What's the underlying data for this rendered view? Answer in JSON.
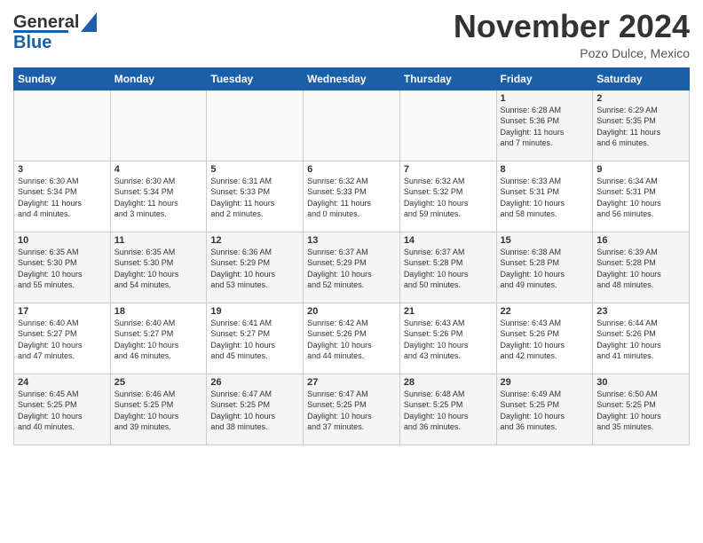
{
  "header": {
    "logo_general": "General",
    "logo_blue": "Blue",
    "month_title": "November 2024",
    "location": "Pozo Dulce, Mexico"
  },
  "weekdays": [
    "Sunday",
    "Monday",
    "Tuesday",
    "Wednesday",
    "Thursday",
    "Friday",
    "Saturday"
  ],
  "weeks": [
    [
      {
        "day": "",
        "info": ""
      },
      {
        "day": "",
        "info": ""
      },
      {
        "day": "",
        "info": ""
      },
      {
        "day": "",
        "info": ""
      },
      {
        "day": "",
        "info": ""
      },
      {
        "day": "1",
        "info": "Sunrise: 6:28 AM\nSunset: 5:36 PM\nDaylight: 11 hours\nand 7 minutes."
      },
      {
        "day": "2",
        "info": "Sunrise: 6:29 AM\nSunset: 5:35 PM\nDaylight: 11 hours\nand 6 minutes."
      }
    ],
    [
      {
        "day": "3",
        "info": "Sunrise: 6:30 AM\nSunset: 5:34 PM\nDaylight: 11 hours\nand 4 minutes."
      },
      {
        "day": "4",
        "info": "Sunrise: 6:30 AM\nSunset: 5:34 PM\nDaylight: 11 hours\nand 3 minutes."
      },
      {
        "day": "5",
        "info": "Sunrise: 6:31 AM\nSunset: 5:33 PM\nDaylight: 11 hours\nand 2 minutes."
      },
      {
        "day": "6",
        "info": "Sunrise: 6:32 AM\nSunset: 5:33 PM\nDaylight: 11 hours\nand 0 minutes."
      },
      {
        "day": "7",
        "info": "Sunrise: 6:32 AM\nSunset: 5:32 PM\nDaylight: 10 hours\nand 59 minutes."
      },
      {
        "day": "8",
        "info": "Sunrise: 6:33 AM\nSunset: 5:31 PM\nDaylight: 10 hours\nand 58 minutes."
      },
      {
        "day": "9",
        "info": "Sunrise: 6:34 AM\nSunset: 5:31 PM\nDaylight: 10 hours\nand 56 minutes."
      }
    ],
    [
      {
        "day": "10",
        "info": "Sunrise: 6:35 AM\nSunset: 5:30 PM\nDaylight: 10 hours\nand 55 minutes."
      },
      {
        "day": "11",
        "info": "Sunrise: 6:35 AM\nSunset: 5:30 PM\nDaylight: 10 hours\nand 54 minutes."
      },
      {
        "day": "12",
        "info": "Sunrise: 6:36 AM\nSunset: 5:29 PM\nDaylight: 10 hours\nand 53 minutes."
      },
      {
        "day": "13",
        "info": "Sunrise: 6:37 AM\nSunset: 5:29 PM\nDaylight: 10 hours\nand 52 minutes."
      },
      {
        "day": "14",
        "info": "Sunrise: 6:37 AM\nSunset: 5:28 PM\nDaylight: 10 hours\nand 50 minutes."
      },
      {
        "day": "15",
        "info": "Sunrise: 6:38 AM\nSunset: 5:28 PM\nDaylight: 10 hours\nand 49 minutes."
      },
      {
        "day": "16",
        "info": "Sunrise: 6:39 AM\nSunset: 5:28 PM\nDaylight: 10 hours\nand 48 minutes."
      }
    ],
    [
      {
        "day": "17",
        "info": "Sunrise: 6:40 AM\nSunset: 5:27 PM\nDaylight: 10 hours\nand 47 minutes."
      },
      {
        "day": "18",
        "info": "Sunrise: 6:40 AM\nSunset: 5:27 PM\nDaylight: 10 hours\nand 46 minutes."
      },
      {
        "day": "19",
        "info": "Sunrise: 6:41 AM\nSunset: 5:27 PM\nDaylight: 10 hours\nand 45 minutes."
      },
      {
        "day": "20",
        "info": "Sunrise: 6:42 AM\nSunset: 5:26 PM\nDaylight: 10 hours\nand 44 minutes."
      },
      {
        "day": "21",
        "info": "Sunrise: 6:43 AM\nSunset: 5:26 PM\nDaylight: 10 hours\nand 43 minutes."
      },
      {
        "day": "22",
        "info": "Sunrise: 6:43 AM\nSunset: 5:26 PM\nDaylight: 10 hours\nand 42 minutes."
      },
      {
        "day": "23",
        "info": "Sunrise: 6:44 AM\nSunset: 5:26 PM\nDaylight: 10 hours\nand 41 minutes."
      }
    ],
    [
      {
        "day": "24",
        "info": "Sunrise: 6:45 AM\nSunset: 5:25 PM\nDaylight: 10 hours\nand 40 minutes."
      },
      {
        "day": "25",
        "info": "Sunrise: 6:46 AM\nSunset: 5:25 PM\nDaylight: 10 hours\nand 39 minutes."
      },
      {
        "day": "26",
        "info": "Sunrise: 6:47 AM\nSunset: 5:25 PM\nDaylight: 10 hours\nand 38 minutes."
      },
      {
        "day": "27",
        "info": "Sunrise: 6:47 AM\nSunset: 5:25 PM\nDaylight: 10 hours\nand 37 minutes."
      },
      {
        "day": "28",
        "info": "Sunrise: 6:48 AM\nSunset: 5:25 PM\nDaylight: 10 hours\nand 36 minutes."
      },
      {
        "day": "29",
        "info": "Sunrise: 6:49 AM\nSunset: 5:25 PM\nDaylight: 10 hours\nand 36 minutes."
      },
      {
        "day": "30",
        "info": "Sunrise: 6:50 AM\nSunset: 5:25 PM\nDaylight: 10 hours\nand 35 minutes."
      }
    ]
  ]
}
